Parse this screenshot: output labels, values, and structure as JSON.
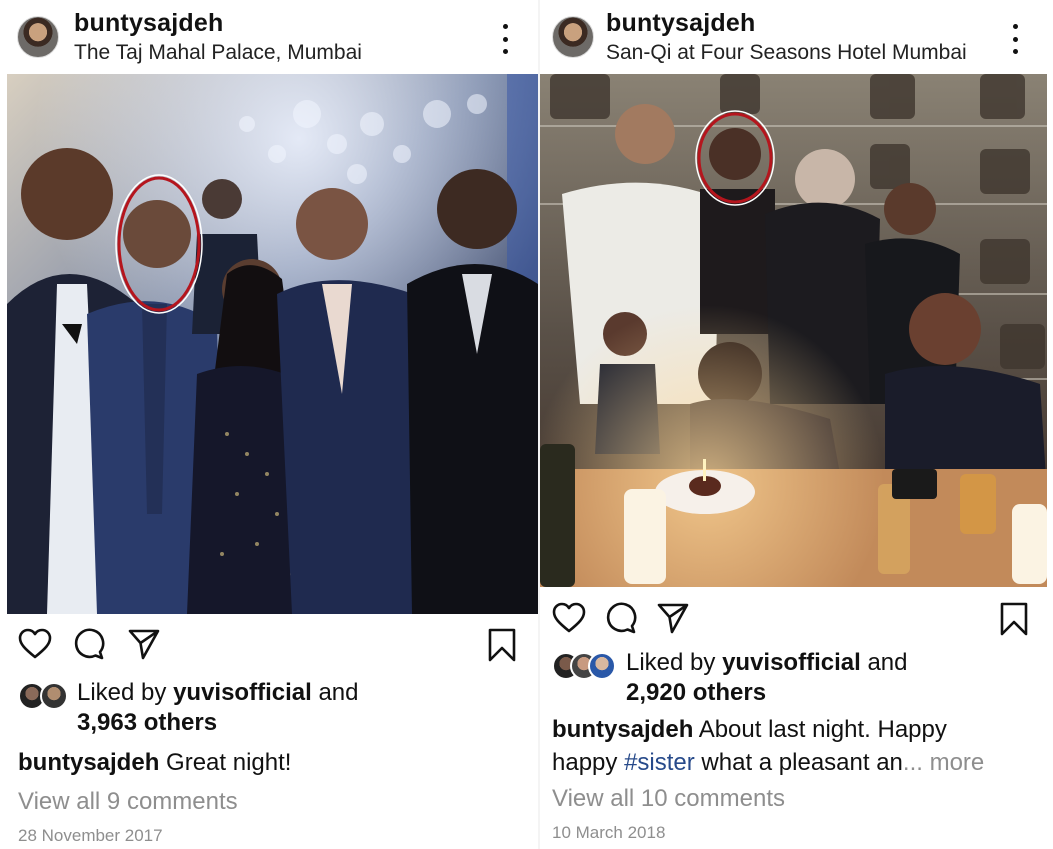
{
  "posts": [
    {
      "username": "buntysajdeh",
      "location": "The Taj Mahal Palace, Mumbai",
      "liked_prefix": "Liked by ",
      "liked_user": "yuvisofficial",
      "liked_and": " and",
      "likes_others": "3,963 others",
      "caption_user": "buntysajdeh",
      "caption_text": " Great night!",
      "view_comments": "View all 9 comments",
      "date": "28 November 2017"
    },
    {
      "username": "buntysajdeh",
      "location": "San-Qi at Four Seasons Hotel Mumbai",
      "liked_prefix": "Liked by ",
      "liked_user": "yuvisofficial",
      "liked_and": " and",
      "likes_others": "2,920 others",
      "caption_user": "buntysajdeh",
      "caption_text": " About last night. Happy",
      "caption_line2_start": "happy ",
      "caption_hashtag": "#sister",
      "caption_line2_rest": " what a pleasant an",
      "caption_more": "... more",
      "view_comments": "View all 10 comments",
      "date": "10 March 2018"
    }
  ],
  "icons": {
    "like": "heart-icon",
    "comment": "comment-icon",
    "share": "send-icon",
    "save": "bookmark-icon",
    "options": "more-options-icon"
  },
  "colors": {
    "text": "#111111",
    "muted": "#8e8e8e",
    "hashtag": "#274a8a",
    "highlight_circle": "#b5151d"
  }
}
